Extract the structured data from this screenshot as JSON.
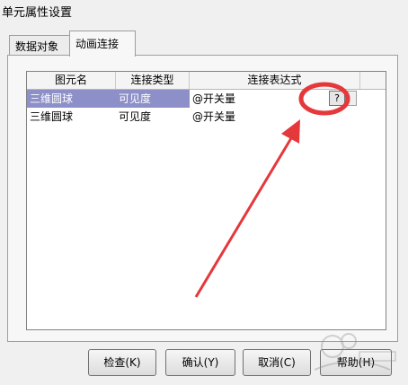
{
  "window": {
    "title": "单元属性设置"
  },
  "tabs": [
    {
      "label": "数据对象",
      "active": false
    },
    {
      "label": "动画连接",
      "active": true
    }
  ],
  "table": {
    "columns": [
      "图元名",
      "连接类型",
      "连接表达式"
    ],
    "rows": [
      {
        "element": "三维圆球",
        "type": "可见度",
        "expression": "@开关量",
        "selected": true
      },
      {
        "element": "三维圆球",
        "type": "可见度",
        "expression": "@开关量",
        "selected": false
      }
    ],
    "expression_button": "?"
  },
  "buttons": {
    "check": "检查(K)",
    "confirm": "确认(Y)",
    "cancel": "取消(C)",
    "help": "帮助(H)"
  },
  "annotation": {
    "color": "#e5383b"
  },
  "colors": {
    "selection": "#8c8fc8",
    "panel": "#f7f7f7"
  }
}
